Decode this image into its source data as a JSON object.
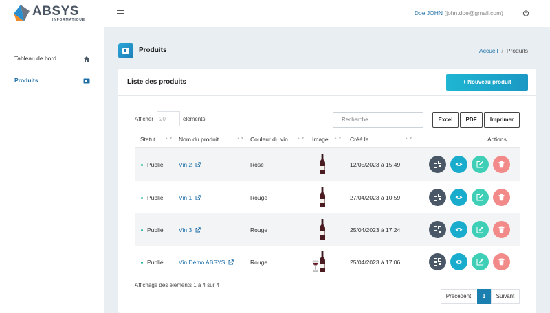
{
  "brand": {
    "name": "ABSYS",
    "sub": "INFORMATIQUE"
  },
  "header": {
    "user_name": "Doe JOHN",
    "user_email": "(john.doe@gmail.com)"
  },
  "sidebar": {
    "items": [
      {
        "label": "Tableau de bord",
        "icon": "home-icon"
      },
      {
        "label": "Produits",
        "icon": "product-card-icon"
      }
    ]
  },
  "page": {
    "title": "Produits",
    "breadcrumb_home": "Accueil",
    "breadcrumb_sep": "/",
    "breadcrumb_current": "Produits"
  },
  "card": {
    "title": "Liste des produits",
    "new_button": "+ Nouveau produit"
  },
  "controls": {
    "show_before": "Afficher",
    "page_size": "20",
    "show_after": "éléments",
    "search_placeholder": "Recherche",
    "export": {
      "excel": "Excel",
      "pdf": "PDF",
      "print": "Imprimer"
    }
  },
  "table": {
    "columns": {
      "status": "Statut",
      "name": "Nom du produit",
      "color": "Couleur du vin",
      "image": "Image",
      "created": "Créé le",
      "actions": "Actions"
    },
    "rows": [
      {
        "status": "Publié",
        "name": "Vin 2",
        "color": "Rosé",
        "created": "12/05/2023 à 15:49",
        "image": "bottle"
      },
      {
        "status": "Publié",
        "name": "Vin 1",
        "color": "Rouge",
        "created": "27/04/2023 à 10:59",
        "image": "bottle"
      },
      {
        "status": "Publié",
        "name": "Vin 3",
        "color": "Rouge",
        "created": "25/04/2023 à 17:24",
        "image": "bottle"
      },
      {
        "status": "Publié",
        "name": "Vin Démo ABSYS",
        "color": "Rouge",
        "created": "25/04/2023 à 17:06",
        "image": "bottle-and-glass"
      }
    ]
  },
  "footer": {
    "info": "Affichage des éléments 1 à 4 sur 4",
    "prev": "Précédent",
    "page": "1",
    "next": "Suivant"
  },
  "colors": {
    "accent": "#1a98c4",
    "link": "#1e6fa8",
    "status_dot": "#2bb3a0",
    "qr_btn": "#4a5766",
    "view_btn": "#1aaccc",
    "edit_btn": "#3fcfb7",
    "delete_btn": "#f38a8a"
  }
}
